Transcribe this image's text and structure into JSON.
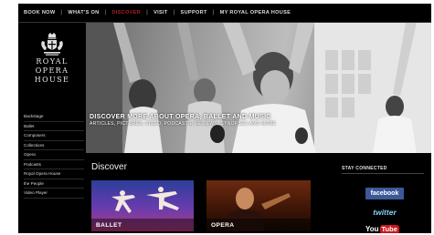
{
  "topnav": {
    "items": [
      {
        "label": "BOOK NOW"
      },
      {
        "label": "WHAT'S ON"
      },
      {
        "label": "DISCOVER"
      },
      {
        "label": "VISIT"
      },
      {
        "label": "SUPPORT"
      },
      {
        "label": "MY ROYAL OPERA HOUSE"
      }
    ],
    "active_color": "#b01c22"
  },
  "logo": {
    "line1": "ROYAL",
    "line2": "OPERA",
    "line3": "HOUSE",
    "crest_icon": "royal-crest-icon"
  },
  "sidebar": {
    "items": [
      {
        "label": "Backstage"
      },
      {
        "label": "Ballet"
      },
      {
        "label": "Composers"
      },
      {
        "label": "Collections"
      },
      {
        "label": "Opera"
      },
      {
        "label": "Podcasts"
      },
      {
        "label": "Royal Opera House"
      },
      {
        "label": "the People"
      },
      {
        "label": "Video Player"
      }
    ]
  },
  "hero": {
    "headline": "DISCOVER MORE ABOUT OPERA, BALLET AND MUSIC",
    "subline": "ARTICLES, PICTURES, VIDEO, PODCASTS, REVIEWS, SYNOPSES AND MORE"
  },
  "discover": {
    "heading": "Discover",
    "tiles": [
      {
        "label": "BALLET"
      },
      {
        "label": "OPERA"
      }
    ]
  },
  "social": {
    "heading": "STAY CONNECTED",
    "facebook": "facebook",
    "twitter": "twitter",
    "youtube_you": "You",
    "youtube_tube": "Tube",
    "facebook_color": "#3b5998",
    "youtube_color": "#cc181e"
  }
}
